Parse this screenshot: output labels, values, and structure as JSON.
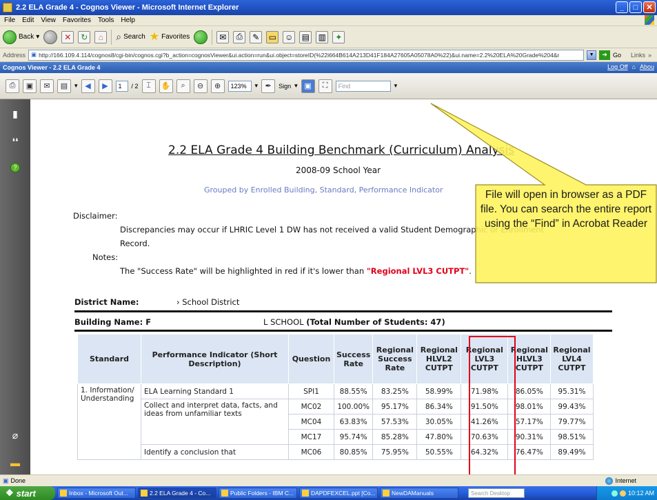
{
  "window": {
    "title": "2.2 ELA Grade 4 - Cognos Viewer - Microsoft Internet Explorer"
  },
  "menu": [
    "File",
    "Edit",
    "View",
    "Favorites",
    "Tools",
    "Help"
  ],
  "ie_toolbar": {
    "back": "Back",
    "search": "Search",
    "favorites": "Favorites"
  },
  "address": {
    "label": "Address",
    "url": "http://166.109.4.114/cognos8/cgi-bin/cognos.cgi?b_action=cognosViewer&ui.action=run&ui.object=storeID(%22i664B614A213D41F184A27605A05078A0%22)&ui.name=2.2%20ELA%20Grade%204&r",
    "go": "Go",
    "links": "Links"
  },
  "cognos_header": {
    "title": "Cognos Viewer - 2.2 ELA Grade 4",
    "logoff": "Log Off",
    "about": "Abou"
  },
  "acrobat": {
    "page_current": "1",
    "page_total": "/ 2",
    "zoom": "123%",
    "sign": "Sign",
    "find_placeholder": "Find"
  },
  "report": {
    "title": "2.2 ELA Grade 4 Building Benchmark (Curriculum) Analysis",
    "school_year": "2008-09 School Year",
    "grouped_by": "Grouped by Enrolled Building, Standard, Performance Indicator",
    "disclaimer_label": "Disclaimer:",
    "disclaimer_text_1": "Discrepancies may occur if LHRIC Level 1 DW has not received a valid Student Demographic or Enrollment",
    "disclaimer_text_2": "Record.",
    "notes_label": "Notes:",
    "notes_text": "The \"Success Rate\" will be highlighted in red if it's lower than ",
    "notes_highlight": "\"Regional LVL3 CUTPT\"",
    "notes_end": ".",
    "district_label": "District Name:",
    "district_value": "› School District",
    "building_label": "Building Name: F",
    "building_value": "L SCHOOL",
    "building_total": "(Total Number of Students: 47)"
  },
  "table": {
    "headers": [
      "Standard",
      "Performance Indicator (Short Description)",
      "Question",
      "Success Rate",
      "Regional Success Rate",
      "Regional HLVL2 CUTPT",
      "Regional LVL3 CUTPT",
      "Regional HLVL3 CUTPT",
      "Regional LVL4 CUTPT"
    ],
    "standard": "1. Information/ Understanding",
    "rows": [
      {
        "indicator": "ELA Learning Standard 1",
        "question": "SPI1",
        "success": "88.55%",
        "reg_success": "83.25%",
        "hlvl2": "58.99%",
        "lvl3": "71.98%",
        "hlvl3": "86.05%",
        "lvl4": "95.31%"
      },
      {
        "indicator": "Collect and interpret data, facts, and ideas from unfamiliar texts",
        "question": "MC02",
        "success": "100.00%",
        "reg_success": "95.17%",
        "hlvl2": "86.34%",
        "lvl3": "91.50%",
        "hlvl3": "98.01%",
        "lvl4": "99.43%"
      },
      {
        "indicator": "",
        "question": "MC04",
        "success": "63.83%",
        "reg_success": "57.53%",
        "hlvl2": "30.05%",
        "lvl3": "41.26%",
        "hlvl3": "57.17%",
        "lvl4": "79.77%"
      },
      {
        "indicator": "",
        "question": "MC17",
        "success": "95.74%",
        "reg_success": "85.28%",
        "hlvl2": "47.80%",
        "lvl3": "70.63%",
        "hlvl3": "90.31%",
        "lvl4": "98.51%"
      },
      {
        "indicator": "Identify a conclusion that",
        "question": "MC06",
        "success": "80.85%",
        "reg_success": "75.95%",
        "hlvl2": "50.55%",
        "lvl3": "64.32%",
        "hlvl3": "76.47%",
        "lvl4": "89.49%"
      }
    ]
  },
  "callout": {
    "text": "File will open in browser as a PDF file.  You can search the entire report using the “Find” in Acrobat Reader",
    "fill": "#fef35a"
  },
  "status": {
    "left": "Done",
    "zone": "Internet"
  },
  "taskbar": {
    "start": "start",
    "tasks": [
      "Inbox - Microsoft Out...",
      "2.2 ELA Grade 4 - Co...",
      "Public Folders - IBM C...",
      "DAPDFEXCEL.ppt [Co...",
      "NewDAManuals"
    ],
    "search_desktop": "Search Desktop",
    "clock": "10:12 AM"
  }
}
